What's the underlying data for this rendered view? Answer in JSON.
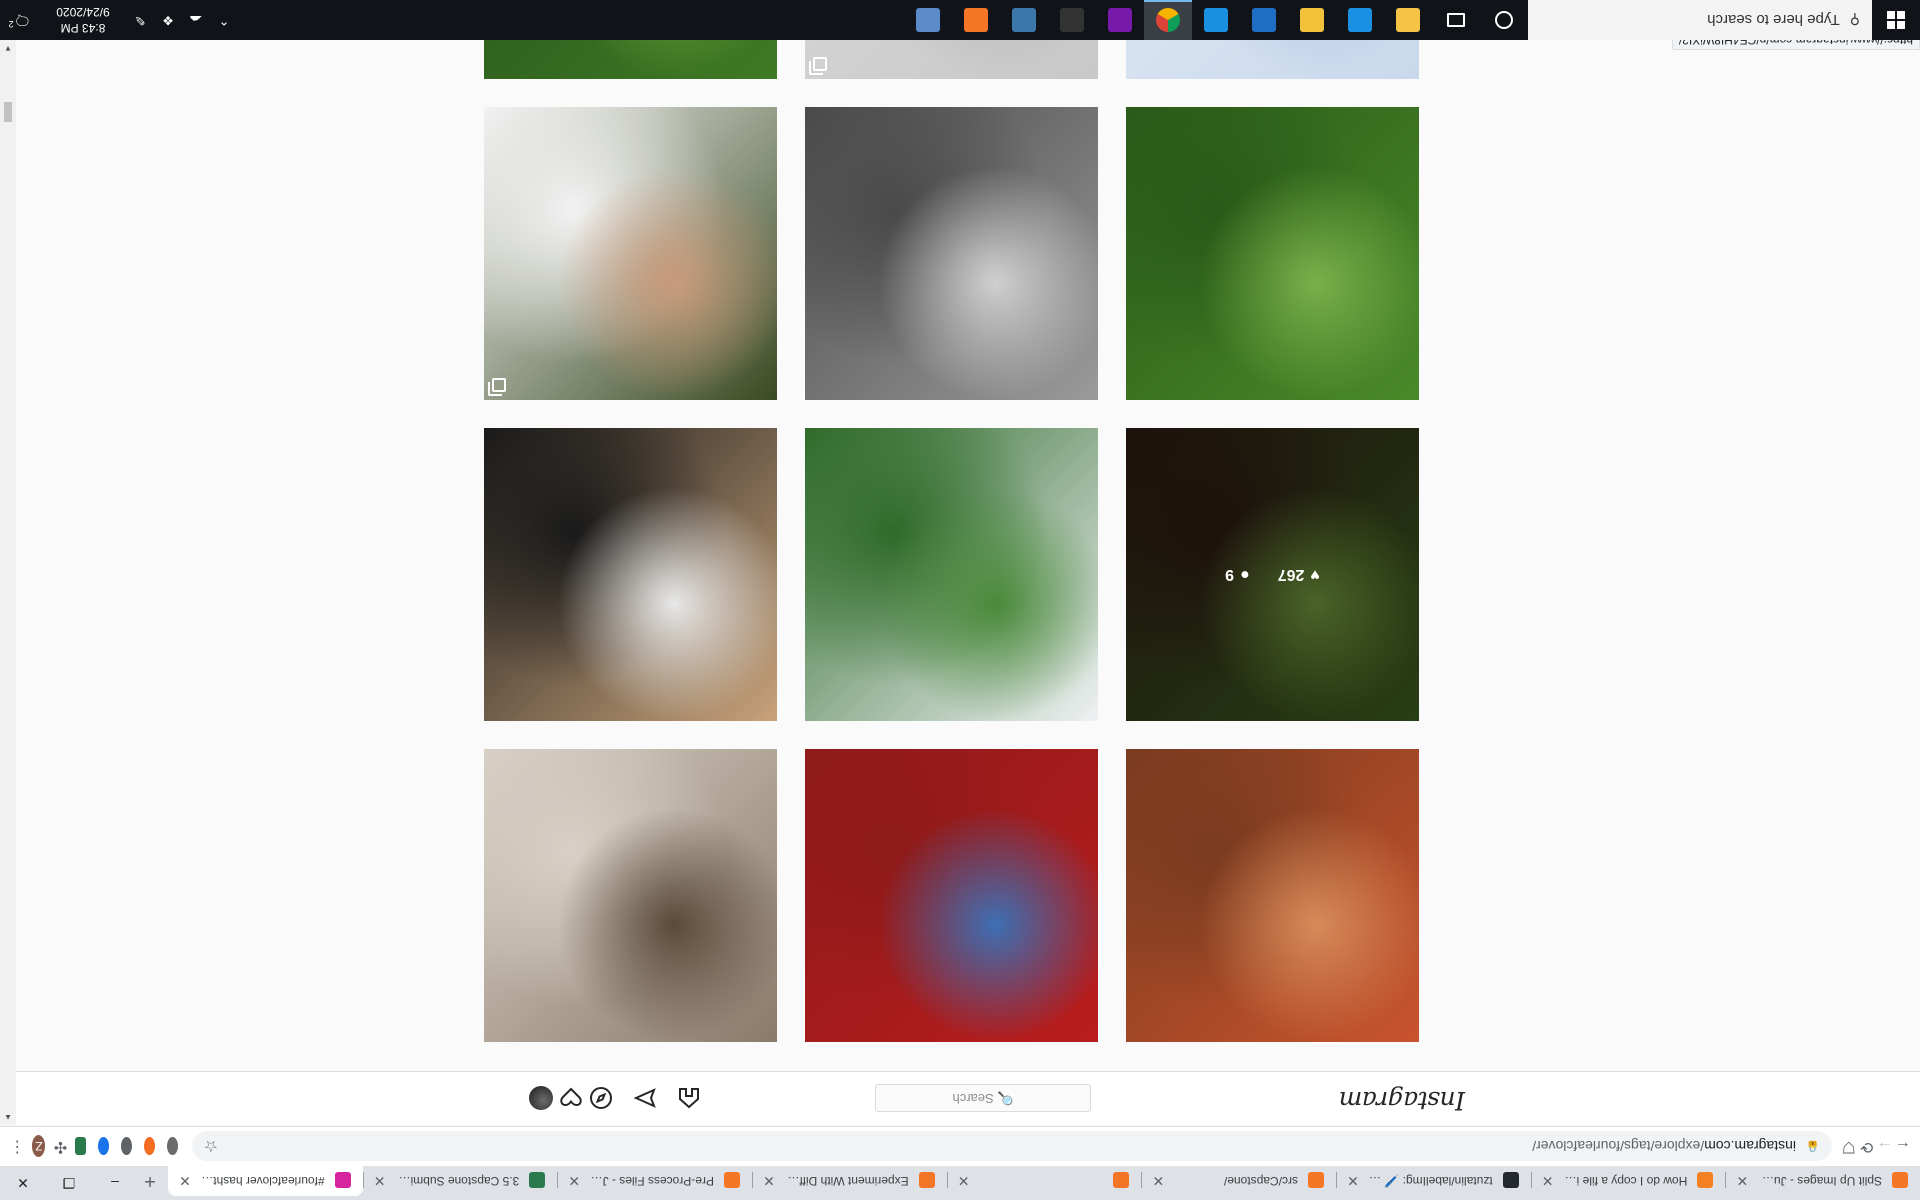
{
  "browser": {
    "tabs": [
      {
        "label": "Split Up Images - Jupyter N",
        "favicon_color": "#f37626",
        "active": false
      },
      {
        "label": "How do I copy a file in Pyth",
        "favicon_color": "#f48024",
        "active": false
      },
      {
        "label": "tzutalin/labelImg: 🖊️ Label",
        "favicon_color": "#24292e",
        "active": false
      },
      {
        "label": "src/Capstone/",
        "favicon_color": "#f37626",
        "active": false
      },
      {
        "label": "",
        "favicon_color": "#f37626",
        "active": false
      },
      {
        "label": "Experiment With Different",
        "favicon_color": "#f37626",
        "active": false
      },
      {
        "label": "Pre-Process Files - Jupyter",
        "favicon_color": "#f37626",
        "active": false
      },
      {
        "label": "3.5 Capstone Submission - I",
        "favicon_color": "#2b7a4b",
        "active": false
      },
      {
        "label": "#fourleafclover hashtag on",
        "favicon_color": "#d6249f",
        "active": true
      }
    ],
    "new_tab_label": "+",
    "window_controls": {
      "minimize": "–",
      "maximize": "❐",
      "close": "✕"
    },
    "back": "←",
    "forward": "→",
    "reload": "⟳",
    "url_host": "instagram.com",
    "url_path": "/explore/tags/fourleafclover/",
    "status_url": "https://www.instagram.com/p/CE4HI8WjXI2/",
    "profile_letter": "Z"
  },
  "instagram": {
    "logo": "Instagram",
    "search_placeholder": "🔍 Search",
    "nav_icons": [
      "home-icon",
      "messenger-icon",
      "explore-icon",
      "activity-heart-icon",
      "profile-avatar"
    ],
    "posts": [
      {
        "subject": "girl in red floral dress",
        "colors": [
          "#c9542e",
          "#7a3b1f",
          "#d88a5a"
        ],
        "likes": "",
        "comments": "",
        "multi": false
      },
      {
        "subject": "tintin book with clover",
        "colors": [
          "#b91c1c",
          "#8f1a1a",
          "#3d6fb4"
        ],
        "likes": "",
        "comments": "",
        "multi": false
      },
      {
        "subject": "cat and clover on rug",
        "colors": [
          "#8a7a6a",
          "#d8d0c6",
          "#5a4a3a"
        ],
        "likes": "",
        "comments": "",
        "multi": false
      },
      {
        "subject": "dog in grass with clover",
        "colors": [
          "#3a5a1e",
          "#2a1a12",
          "#6b8f3a"
        ],
        "likes": "267",
        "comments": "9",
        "multi": false
      },
      {
        "subject": "clover leaves on white",
        "colors": [
          "#eef1f3",
          "#2f6b2a",
          "#4a8a3a"
        ],
        "likes": "",
        "comments": "",
        "multi": false
      },
      {
        "subject": "clover necklace jewelry",
        "colors": [
          "#c8a27a",
          "#1a1a1a",
          "#e8e8e8"
        ],
        "likes": "",
        "comments": "",
        "multi": false
      },
      {
        "subject": "clover patch in grass",
        "colors": [
          "#4a8a2a",
          "#2a5a18",
          "#7ab04a"
        ],
        "likes": "",
        "comments": "",
        "multi": false
      },
      {
        "subject": "black and white clover in hand",
        "colors": [
          "#9a9a9a",
          "#4a4a4a",
          "#d0d0d0"
        ],
        "likes": "",
        "comments": "",
        "multi": false
      },
      {
        "subject": "mother and baby",
        "colors": [
          "#3a4a22",
          "#f2f2f2",
          "#c89a7a"
        ],
        "likes": "",
        "comments": "",
        "multi": true
      },
      {
        "subject": "sky",
        "colors": [
          "#c9d8ec",
          "#e2ebf5",
          "#b0c6e2"
        ],
        "likes": "",
        "comments": "",
        "multi": false
      },
      {
        "subject": "grey",
        "colors": [
          "#c8c8c8",
          "#d9d9d9",
          "#b5b5b5"
        ],
        "likes": "",
        "comments": "",
        "multi": true
      },
      {
        "subject": "green grass",
        "colors": [
          "#3f7a24",
          "#24501a",
          "#6aa03a"
        ],
        "likes": "",
        "comments": "",
        "multi": false
      }
    ]
  },
  "taskbar": {
    "search_placeholder": "Type here to search",
    "apps": [
      {
        "name": "cortana-icon",
        "color": "#ffffff"
      },
      {
        "name": "task-view-icon",
        "color": "#ffffff"
      },
      {
        "name": "file-explorer-icon",
        "color": "#f6c344"
      },
      {
        "name": "edge-icon",
        "color": "#1a8fe3"
      },
      {
        "name": "folder-icon",
        "color": "#f3c13a"
      },
      {
        "name": "photoshop-icon",
        "color": "#1f6fc6"
      },
      {
        "name": "photos-icon",
        "color": "#1b8fe0"
      },
      {
        "name": "chrome-icon",
        "color": "#e8a43a"
      },
      {
        "name": "onenote-icon",
        "color": "#7719aa"
      },
      {
        "name": "terminal-icon",
        "color": "#333333"
      },
      {
        "name": "python-icon",
        "color": "#3b77a8"
      },
      {
        "name": "jupyter-icon",
        "color": "#f37626"
      },
      {
        "name": "calculator-icon",
        "color": "#5a8ac8"
      }
    ],
    "time": "8:43 PM",
    "date": "9/24/2020",
    "notification_count": "2"
  }
}
